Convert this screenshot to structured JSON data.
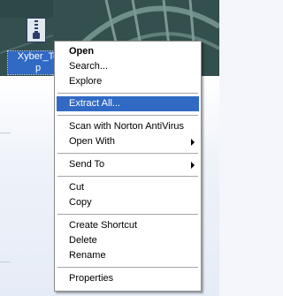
{
  "desktop": {
    "icon_label": "Xyber_Te p",
    "icon_label_lines": [
      "Xyber_Te",
      "p"
    ],
    "icon_name": "zip-archive-icon"
  },
  "context_menu": {
    "items": [
      {
        "label": "Open",
        "bold": true
      },
      {
        "label": "Search..."
      },
      {
        "label": "Explore"
      },
      {
        "label": "Extract All...",
        "highlighted": true
      },
      {
        "label": "Scan with Norton AntiVirus"
      },
      {
        "label": "Open With",
        "submenu": true
      },
      {
        "label": "Send To",
        "submenu": true
      },
      {
        "label": "Cut"
      },
      {
        "label": "Copy"
      },
      {
        "label": "Create Shortcut"
      },
      {
        "label": "Delete"
      },
      {
        "label": "Rename"
      },
      {
        "label": "Properties"
      }
    ]
  },
  "colors": {
    "highlight": "#316ac5",
    "menu_background": "#ffffff",
    "separator": "#a7a6aa"
  }
}
